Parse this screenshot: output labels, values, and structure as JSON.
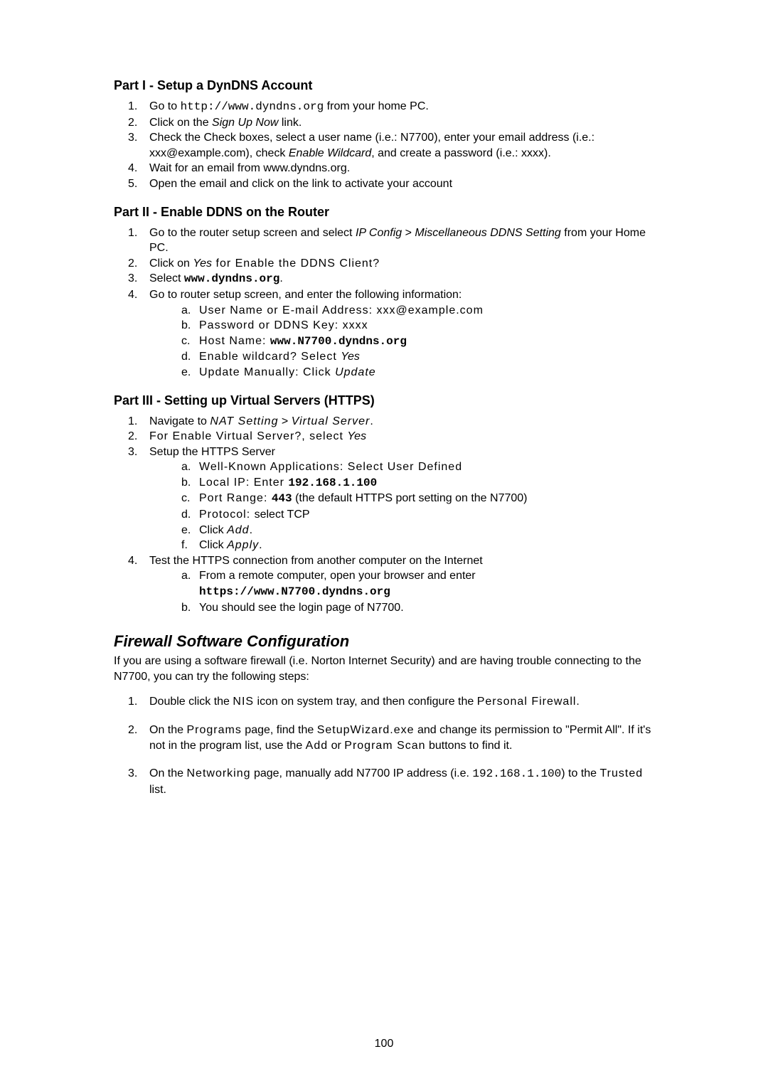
{
  "part1": {
    "heading": "Part I - Setup a DynDNS Account",
    "items": [
      {
        "num": "1.",
        "pre": "Go to ",
        "mono": "http://www.dyndns.org",
        "post": " from your home PC."
      },
      {
        "num": "2.",
        "pre": "Click on the ",
        "italic": "Sign Up Now",
        "post": " link."
      },
      {
        "num": "3.",
        "pre": "Check the Check boxes, select a user name (i.e.: N7700), enter your email address (i.e.: xxx@example.com), check ",
        "italic": "Enable Wildcard",
        "post": ", and create a password (i.e.: xxxx)."
      },
      {
        "num": "4.",
        "text": "Wait for an email from www.dyndns.org."
      },
      {
        "num": "5.",
        "text": "Open the email and click on the link to activate your account"
      }
    ]
  },
  "part2": {
    "heading": "Part II - Enable DDNS on the Router",
    "items": [
      {
        "num": "1.",
        "pre": "Go to the router setup screen and select ",
        "italic": "IP Config",
        "bridge": " > ",
        "italic2": "Miscellaneous DDNS Setting",
        "post": " from your Home PC."
      },
      {
        "num": "2.",
        "pre": "Click on ",
        "italic": "Yes",
        "post_spaced": " for Enable the DDNS Client?"
      },
      {
        "num": "3.",
        "pre": "Select ",
        "monob": "www.dyndns.org",
        "post": "."
      },
      {
        "num": "4.",
        "text": "Go to router setup screen, and enter the following information:",
        "sub": [
          {
            "letter": "a.",
            "pre_spaced": "User Name or E-mail Address: ",
            "post_spaced": "xxx@example.com"
          },
          {
            "letter": "b.",
            "text_spaced": "Password or DDNS Key: xxxx"
          },
          {
            "letter": "c.",
            "pre_spaced": "Host Name: ",
            "monob": "www.N7700.dyndns.org"
          },
          {
            "letter": "d.",
            "pre_spaced": "Enable wildcard? Select ",
            "italic": "Yes"
          },
          {
            "letter": "e.",
            "pre_spaced": "Update Manually: Click ",
            "italic_spaced": "Update"
          }
        ]
      }
    ]
  },
  "part3": {
    "heading": "Part III - Setting up Virtual Servers (HTTPS)",
    "items": [
      {
        "num": "1.",
        "pre": "Navigate to ",
        "italic_spaced": "NAT Setting",
        "bridge": " > ",
        "italic_spaced2": "Virtual Server",
        "post": "."
      },
      {
        "num": "2.",
        "pre_spaced": "For Enable Virtual Server?, select ",
        "italic": "Yes"
      },
      {
        "num": "3.",
        "text": "Setup the HTTPS Server",
        "sub": [
          {
            "letter": "a.",
            "pre_spaced": "Well-Known Applications: ",
            "post_spaced": "Select User Defined"
          },
          {
            "letter": "b.",
            "pre_spaced": "Local IP: Enter ",
            "monob": "192.168.1.100"
          },
          {
            "letter": "c.",
            "pre_spaced": "Port Range: ",
            "monob": "443",
            "post": " (the default HTTPS port setting on the N7700)"
          },
          {
            "letter": "d.",
            "pre_spaced": "Protocol: ",
            "post": "select TCP"
          },
          {
            "letter": "e.",
            "pre": "Click ",
            "italic_spaced": "Add",
            "post": "."
          },
          {
            "letter": "f.",
            "pre": "Click ",
            "italic_spaced": "Apply",
            "post": "."
          }
        ]
      },
      {
        "num": "4.",
        "text": "Test the HTTPS connection from another computer on the Internet",
        "sub": [
          {
            "letter": "a.",
            "pre": "From a remote computer, open your browser and enter ",
            "monob_block": "https://www.N7700.dyndns.org"
          },
          {
            "letter": "b.",
            "text": "You should see the login page of N7700."
          }
        ]
      }
    ]
  },
  "firewall": {
    "heading": "Firewall Software Configuration",
    "intro": "If you are using a software firewall (i.e. Norton Internet Security) and are having trouble connecting to the N7700, you can try the following steps:",
    "items": [
      {
        "num": "1.",
        "pre": "Double click the ",
        "spaced": "NIS",
        "bridge": " icon on system tray, and then configure the ",
        "spaced2": "Personal Firewall."
      },
      {
        "num": "2.",
        "pre": "On the ",
        "spaced": "Programs",
        "bridge": " page, find the ",
        "spaced2": "SetupWizard.exe",
        "bridge2": " and change its permission to \"Permit All\". If it's not in the program list, use the ",
        "spaced3": "Add",
        "bridge3": " or ",
        "spaced4": "Program Scan",
        "post": " buttons to find it."
      },
      {
        "num": "3.",
        "pre": "On the ",
        "spaced": "Networking",
        "bridge": " page, manually add N7700 IP address (i.e. ",
        "mono": "192.168.1.100",
        "bridge2": ") to the ",
        "spaced2": "Trusted",
        "post": " list."
      }
    ]
  },
  "page_number": "100"
}
